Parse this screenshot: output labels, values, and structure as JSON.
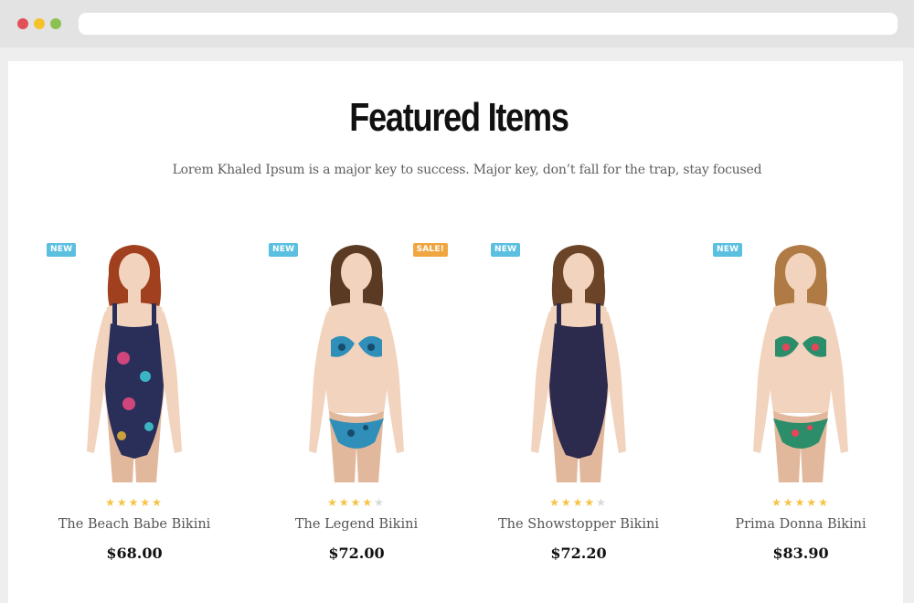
{
  "section": {
    "title": "Featured Items",
    "subtitle": "Lorem Khaled Ipsum is a major key to success. Major key, don’t fall for the trap, stay focused"
  },
  "products": [
    {
      "name": "The Beach Babe Bikini",
      "price": "$68.00",
      "rating": 5,
      "badge_left": "NEW",
      "badge_right": "",
      "swimsuit_color": "#2a2f5a",
      "pattern_color": "#d0467c",
      "hair_color": "#a0401e"
    },
    {
      "name": "The Legend Bikini",
      "price": "$72.00",
      "rating": 4,
      "badge_left": "NEW",
      "badge_right": "SALE!",
      "swimsuit_color": "#2f8fb8",
      "pattern_color": "#164c6e",
      "hair_color": "#5a3a22"
    },
    {
      "name": "The Showstopper Bikini",
      "price": "$72.20",
      "rating": 4,
      "badge_left": "NEW",
      "badge_right": "",
      "swimsuit_color": "#2c2a4d",
      "pattern_color": "#2c2a4d",
      "hair_color": "#6b4428"
    },
    {
      "name": "Prima Donna Bikini",
      "price": "$83.90",
      "rating": 5,
      "badge_left": "NEW",
      "badge_right": "",
      "swimsuit_color": "#2c8d6a",
      "pattern_color": "#e8445a",
      "hair_color": "#b07a45"
    }
  ],
  "colors": {
    "star_on": "#f6c343",
    "star_off": "#d9d9d9",
    "badge_new": "#5bbfe0",
    "badge_sale": "#f0a640"
  }
}
